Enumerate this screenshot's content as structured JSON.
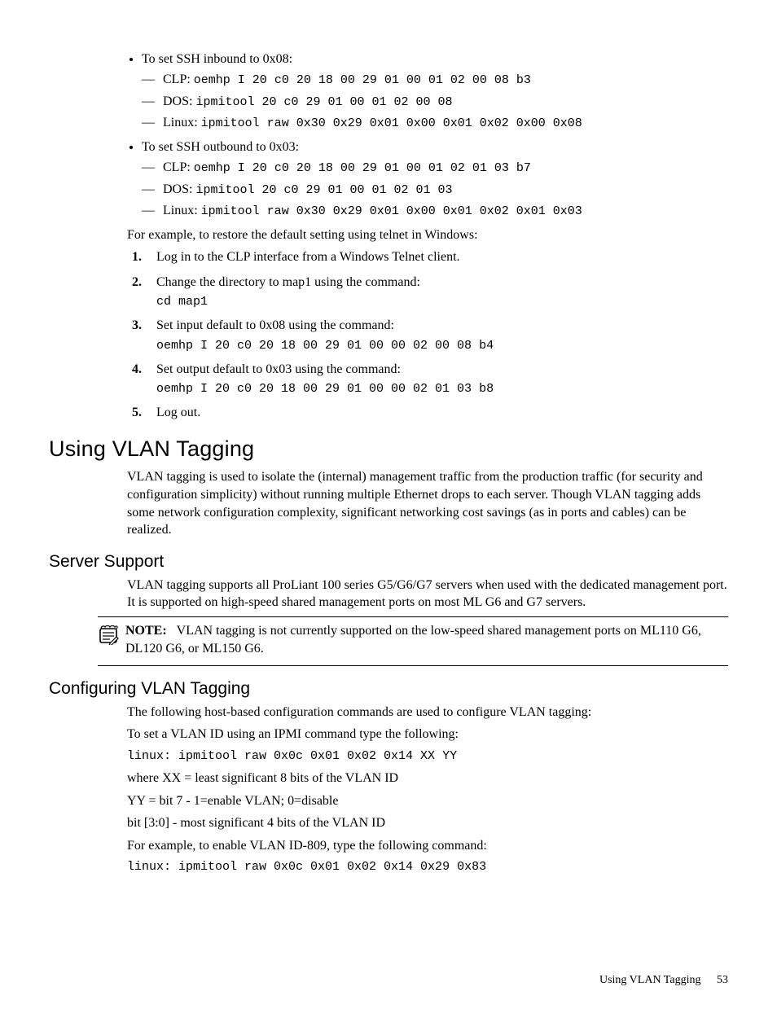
{
  "bullets": {
    "inbound": {
      "title": "To set SSH inbound to 0x08:",
      "clp_label": "CLP:",
      "clp_cmd": "oemhp I 20 c0 20 18 00 29 01 00 01 02 00 08 b3",
      "dos_label": "DOS:",
      "dos_cmd": "ipmitool 20 c0 29 01 00 01 02 00 08",
      "linux_label": "Linux:",
      "linux_cmd": "ipmitool raw 0x30 0x29 0x01 0x00 0x01 0x02 0x00 0x08"
    },
    "outbound": {
      "title": "To set SSH outbound to 0x03:",
      "clp_label": "CLP:",
      "clp_cmd": "oemhp I 20 c0 20 18 00 29 01 00 01 02 01 03 b7",
      "dos_label": "DOS:",
      "dos_cmd": "ipmitool 20 c0 29 01 00 01 02 01 03",
      "linux_label": "Linux:",
      "linux_cmd": "ipmitool raw 0x30 0x29 0x01 0x00 0x01 0x02 0x01 0x03"
    }
  },
  "example_intro": "For example, to restore the default setting using telnet in Windows:",
  "steps": {
    "s1": "Log in to the CLP interface from a Windows Telnet client.",
    "s2": "Change the directory to map1 using the command:",
    "s2_cmd": "cd map1",
    "s3": "Set input default to 0x08 using the command:",
    "s3_cmd": "oemhp I 20 c0 20 18 00 29 01 00 00 02 00 08 b4",
    "s4": "Set output default to 0x03 using the command:",
    "s4_cmd": "oemhp I 20 c0 20 18 00 29 01 00 00 02 01 03 b8",
    "s5": "Log out."
  },
  "h_using": "Using VLAN Tagging",
  "p_using": "VLAN tagging is used to isolate the (internal) management traffic from the production traffic (for security and configuration simplicity) without running multiple Ethernet drops to each server. Though VLAN tagging adds some network configuration complexity, significant networking cost savings (as in ports and cables) can be realized.",
  "h_server": "Server Support",
  "p_server": "VLAN tagging supports all ProLiant 100 series G5/G6/G7 servers when used with the dedicated management port. It is supported on high-speed shared management ports on most ML G6 and G7 servers.",
  "note_label": "NOTE:",
  "note_text": "VLAN tagging is not currently supported on the low-speed shared management ports on ML110 G6, DL120 G6, or ML150 G6.",
  "h_config": "Configuring VLAN Tagging",
  "config": {
    "p1": "The following host-based configuration commands are used to configure VLAN tagging:",
    "p2": "To set a VLAN ID using an IPMI command type the following:",
    "cmd1": "linux: ipmitool raw 0x0c 0x01 0x02 0x14 XX YY",
    "p3": "where XX = least significant 8 bits of the VLAN ID",
    "p4": "YY = bit 7 - 1=enable VLAN; 0=disable",
    "p5": "bit [3:0] - most significant 4 bits of the VLAN ID",
    "p6": "For example, to enable VLAN ID-809, type the following command:",
    "cmd2": "linux: ipmitool raw 0x0c 0x01 0x02 0x14 0x29 0x83"
  },
  "footer": {
    "section": "Using VLAN Tagging",
    "page": "53"
  }
}
